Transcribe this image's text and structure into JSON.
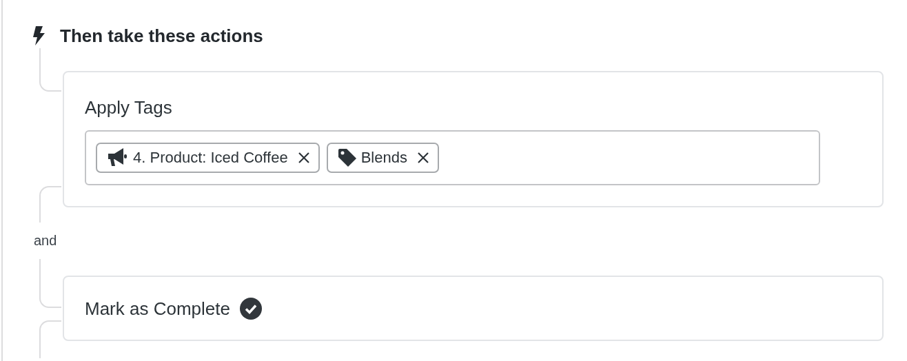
{
  "heading": "Then take these actions",
  "actions": [
    {
      "kind": "tags",
      "title": "Apply Tags",
      "tags": [
        {
          "kind": "campaign",
          "label": "4. Product: Iced Coffee"
        },
        {
          "kind": "tag",
          "label": "Blends"
        }
      ]
    },
    {
      "kind": "complete",
      "title": "Mark as Complete"
    }
  ],
  "joiner": "and"
}
